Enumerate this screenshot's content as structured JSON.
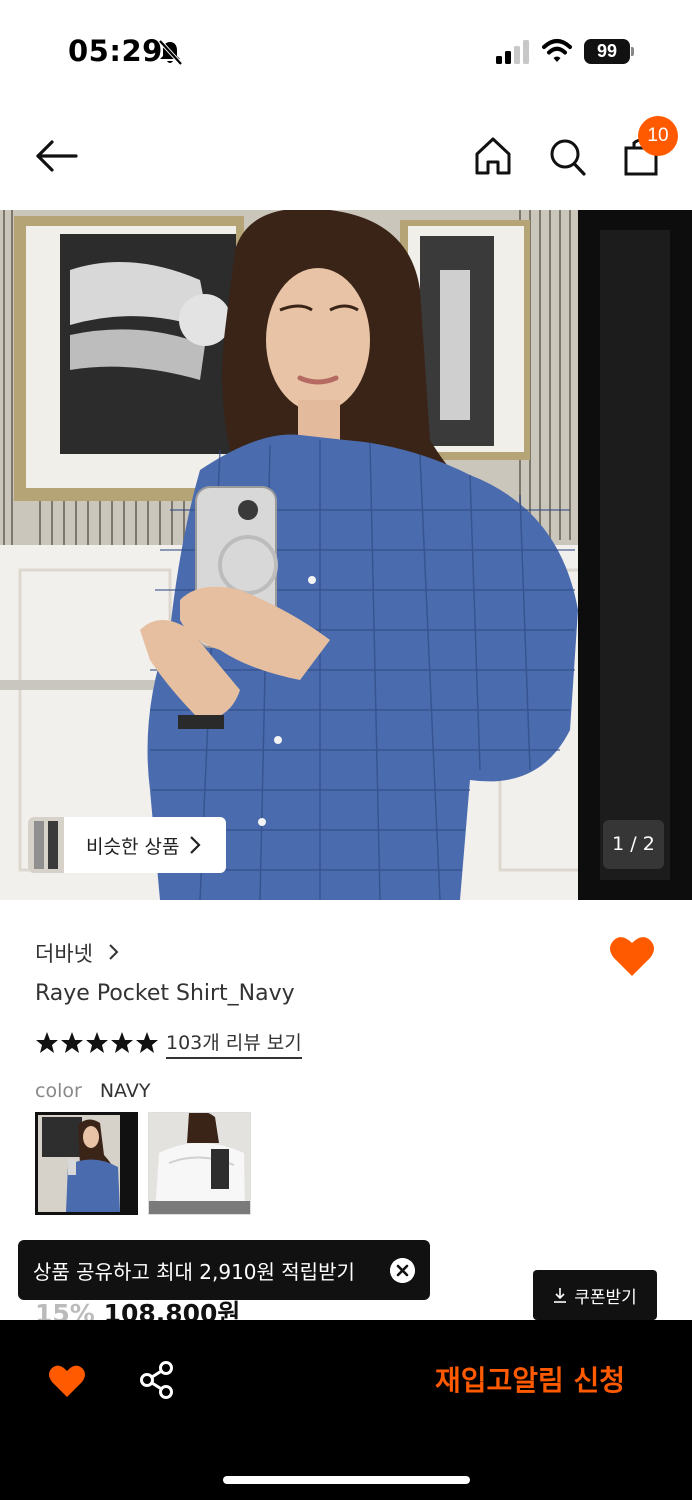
{
  "status_bar": {
    "time": "05:29",
    "battery": "99",
    "icons": [
      "bell-off-icon",
      "cellular-signal-icon",
      "wifi-icon",
      "battery-icon"
    ]
  },
  "nav": {
    "icons": [
      "back-arrow-icon",
      "home-icon",
      "search-icon",
      "shopping-bag-icon"
    ],
    "cart_count": "10"
  },
  "gallery": {
    "similar_label": "비슷한 상품",
    "page_indicator": "1 / 2"
  },
  "product": {
    "brand": "더바넷",
    "name": "Raye Pocket Shirt_Navy",
    "rating_stars": 5,
    "review_link": "103개 리뷰 보기",
    "option_label": "color",
    "option_value": "NAVY",
    "discount": "15%",
    "price": "108,800원"
  },
  "toast": {
    "text": "상품 공유하고 최대 2,910원 적립받기"
  },
  "coupon": {
    "label": "쿠폰받기"
  },
  "bottom_bar": {
    "restock_label": "재입고알림 신청"
  },
  "colors": {
    "accent": "#ff5a00",
    "dark": "#111111",
    "shirt_blue": "#4a6cae"
  }
}
